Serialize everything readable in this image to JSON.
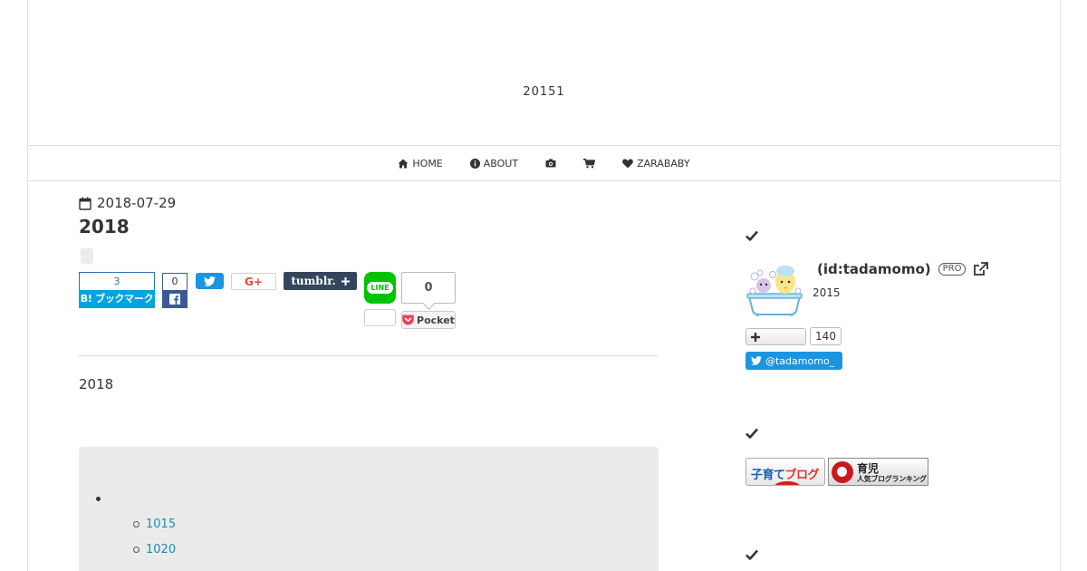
{
  "header": {
    "site_title": "20151"
  },
  "nav": {
    "home": "HOME",
    "about": "ABOUT",
    "zarababy": "ZARABABY"
  },
  "entry": {
    "date": "2018-07-29",
    "title": "2018",
    "intro": "2018"
  },
  "share": {
    "hatena_count": "3",
    "hatena_label": "B! ブックマーク",
    "facebook_count": "0",
    "tumblr_label": "tumblr.",
    "line_label": "LINE",
    "pocket_count": "0",
    "pocket_label": "Pocket",
    "gplus_label": "G+"
  },
  "toc": {
    "items": [
      "1015",
      "1020"
    ]
  },
  "sidebar": {
    "profile_id": "(id:tadamomo)",
    "pro_badge": "PRO",
    "profile_year": "2015",
    "follower_count": "140",
    "twitter_handle": "@tadamomo_",
    "banner1_text_a": "子育て",
    "banner1_text_b": "ブログ",
    "banner2_text_a": "育児",
    "banner2_text_b": "人気ブログランキング"
  },
  "colors": {
    "hatena": "#00a4de",
    "facebook": "#3b5998",
    "twitter": "#1b95e0",
    "tumblr": "#35465c",
    "line": "#00c300",
    "link": "#1a8cb8",
    "toc_bg": "#ebebeb"
  }
}
